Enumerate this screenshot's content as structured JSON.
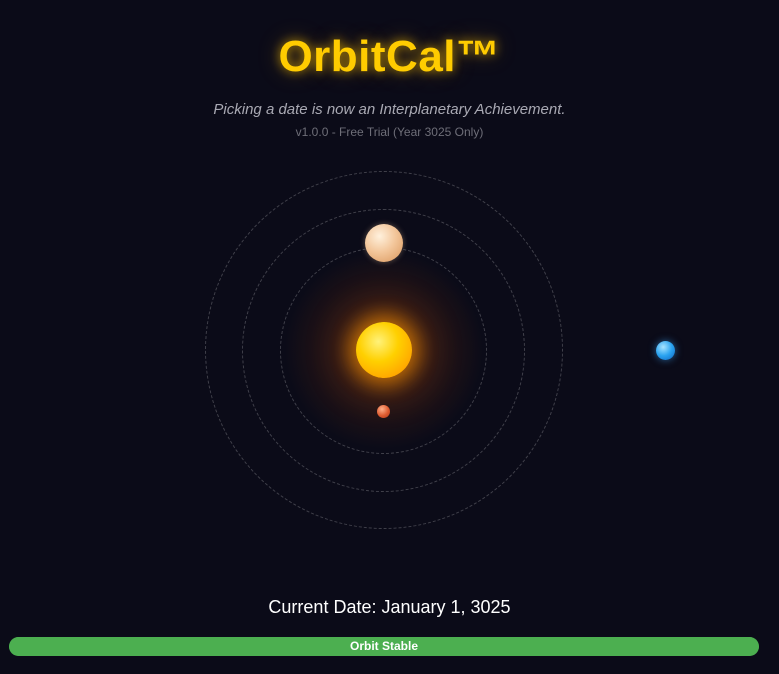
{
  "app": {
    "title": "OrbitCal™",
    "tagline": "Picking a date is now an Interplanetary Achievement.",
    "version": "v1.0.0 - Free Trial (Year 3025 Only)"
  },
  "orbit_view": {
    "sun_icon": "sun-icon",
    "planets": [
      {
        "name": "venus-planet",
        "color": "#f3c79c"
      },
      {
        "name": "mars-planet",
        "color": "#dd5a2e"
      },
      {
        "name": "earth-planet",
        "color": "#2aa3f0"
      }
    ],
    "ring_count": 3
  },
  "date": {
    "current": "Current Date: January 1, 3025"
  },
  "status": {
    "label": "Orbit Stable",
    "progress": 1.0,
    "color": "#4caf50"
  },
  "colors": {
    "background": "#0b0b18",
    "accent": "#ffcc00"
  }
}
